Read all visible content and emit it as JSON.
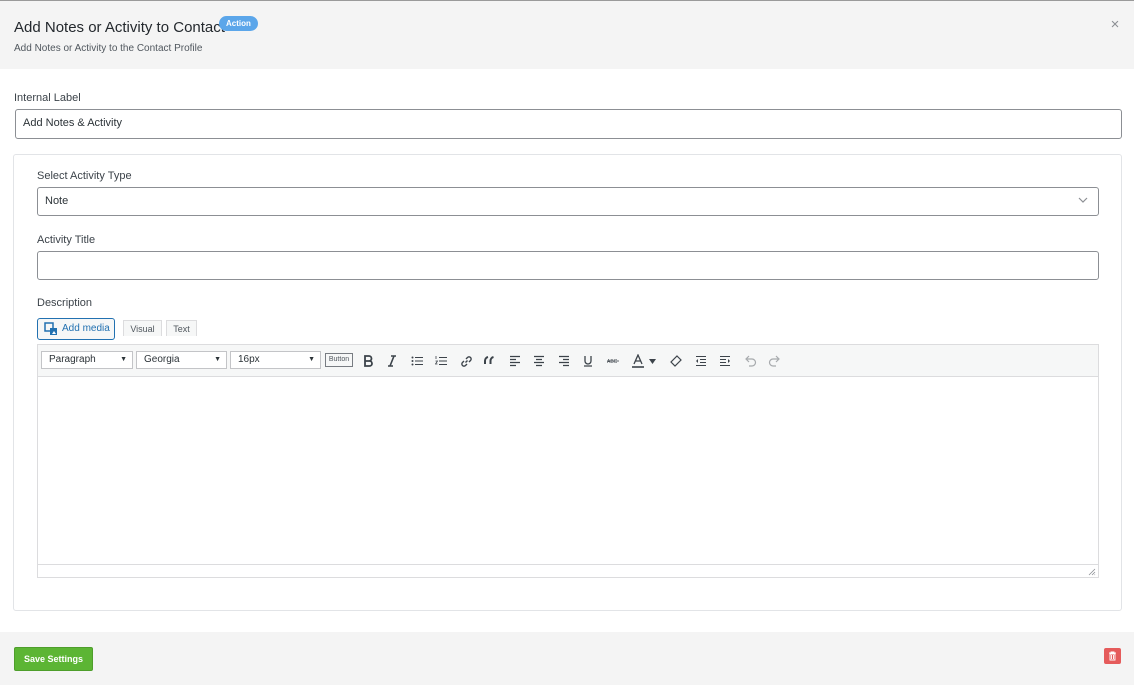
{
  "header": {
    "title": "Add Notes or Activity to Contact",
    "badge": "Action",
    "subtitle": "Add Notes or Activity to the Contact Profile",
    "close_glyph": "×"
  },
  "internal_label": {
    "label": "Internal Label",
    "value": "Add Notes & Activity"
  },
  "activity_type": {
    "label": "Select Activity Type",
    "selected": "Note"
  },
  "activity_title": {
    "label": "Activity Title",
    "value": ""
  },
  "description": {
    "label": "Description",
    "add_media": "Add media",
    "tabs": [
      "Visual",
      "Text"
    ],
    "toolbar": {
      "format": "Paragraph",
      "font": "Georgia",
      "size": "16px",
      "button_label": "Button",
      "icons": [
        "bold-icon",
        "italic-icon",
        "bullet-list-icon",
        "numbered-list-icon",
        "link-icon",
        "blockquote-icon",
        "align-left-icon",
        "align-center-icon",
        "align-right-icon",
        "underline-icon",
        "strikethrough-icon",
        "text-color-icon",
        "clear-formatting-icon",
        "outdent-icon",
        "indent-icon",
        "undo-icon",
        "redo-icon"
      ]
    },
    "content": ""
  },
  "footer": {
    "save_label": "Save Settings"
  },
  "colors": {
    "accent": "#2271b1",
    "badge": "#5ba6ea",
    "save": "#5cb534",
    "delete": "#e55b5b"
  }
}
